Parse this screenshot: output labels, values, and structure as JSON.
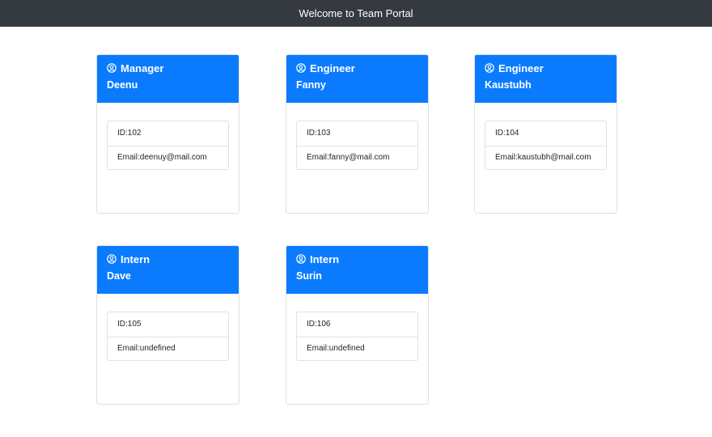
{
  "header": {
    "title": "Welcome to Team Portal"
  },
  "team": [
    {
      "role": "Manager",
      "name": "Deenu",
      "id": "ID:102",
      "email": "Email:deenuy@mail.com",
      "icon": "user-circle-icon"
    },
    {
      "role": "Engineer",
      "name": "Fanny",
      "id": "ID:103",
      "email": "Email:fanny@mail.com",
      "icon": "user-circle-icon"
    },
    {
      "role": "Engineer",
      "name": "Kaustubh",
      "id": "ID:104",
      "email": "Email:kaustubh@mail.com",
      "icon": "user-circle-icon"
    },
    {
      "role": "Intern",
      "name": "Dave",
      "id": "ID:105",
      "email": "Email:undefined",
      "icon": "user-circle-icon"
    },
    {
      "role": "Intern",
      "name": "Surin",
      "id": "ID:106",
      "email": "Email:undefined",
      "icon": "user-circle-icon"
    }
  ],
  "colors": {
    "navbar": "#343a40",
    "card_header": "#0a7bff",
    "border": "#dfe1e4"
  }
}
